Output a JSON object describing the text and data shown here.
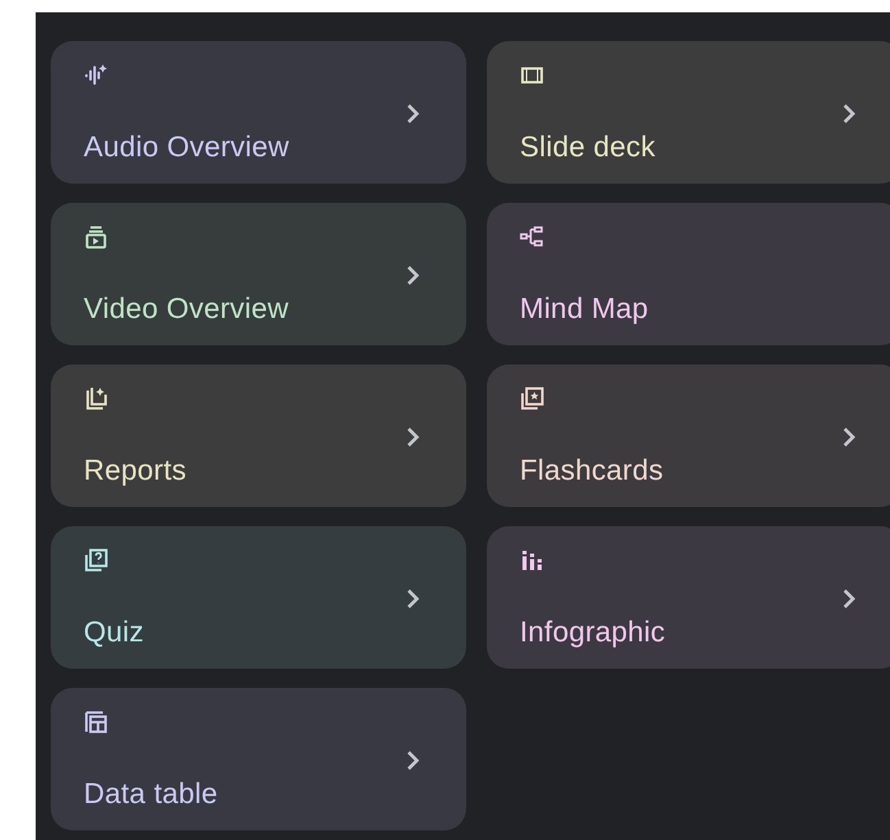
{
  "cards": [
    {
      "kind": "audio",
      "label": "Audio Overview",
      "color": "#cac9f2",
      "chevron": true
    },
    {
      "kind": "slides",
      "label": "Slide deck",
      "color": "#e6e6c2",
      "chevron": true
    },
    {
      "kind": "video",
      "label": "Video Overview",
      "color": "#bfe3c6",
      "chevron": true
    },
    {
      "kind": "mindmap",
      "label": "Mind Map",
      "color": "#f0c8ee",
      "chevron": false
    },
    {
      "kind": "reports",
      "label": "Reports",
      "color": "#e8e3c2",
      "chevron": true
    },
    {
      "kind": "flashcards",
      "label": "Flashcards",
      "color": "#f0d8ce",
      "chevron": true
    },
    {
      "kind": "quiz",
      "label": "Quiz",
      "color": "#b8e6e6",
      "chevron": true
    },
    {
      "kind": "infographic",
      "label": "Infographic",
      "color": "#f0c8ee",
      "chevron": true
    },
    {
      "kind": "table",
      "label": "Data table",
      "color": "#cac9f2",
      "chevron": true
    }
  ]
}
